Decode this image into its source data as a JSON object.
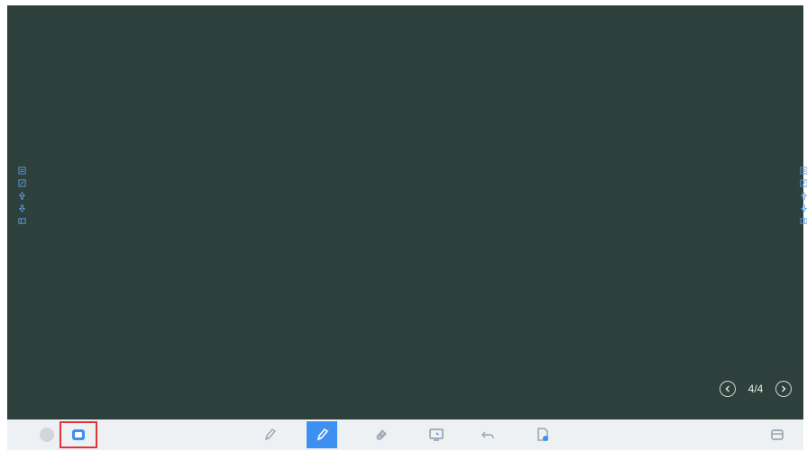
{
  "board": {
    "background_color": "#2e403b"
  },
  "side_toolbar_left": {
    "items": [
      "menu-icon",
      "edit-icon",
      "upload-icon",
      "download-icon",
      "fold-icon"
    ]
  },
  "side_toolbar_right": {
    "items": [
      "menu-icon",
      "edit-icon",
      "upload-icon",
      "download-icon",
      "fold-icon"
    ]
  },
  "pager": {
    "page_label": "4/4"
  },
  "toolbar": {
    "accent_color": "#3d8ff2",
    "highlight_color": "#e0343a",
    "items": [
      {
        "name": "toggle-icon"
      },
      {
        "name": "minimize-icon",
        "highlighted": true
      },
      {
        "name": "pencil-icon"
      },
      {
        "name": "pen-icon",
        "active": true
      },
      {
        "name": "eraser-icon"
      },
      {
        "name": "screen-icon"
      },
      {
        "name": "undo-icon"
      },
      {
        "name": "file-settings-icon"
      },
      {
        "name": "window-icon"
      }
    ]
  }
}
